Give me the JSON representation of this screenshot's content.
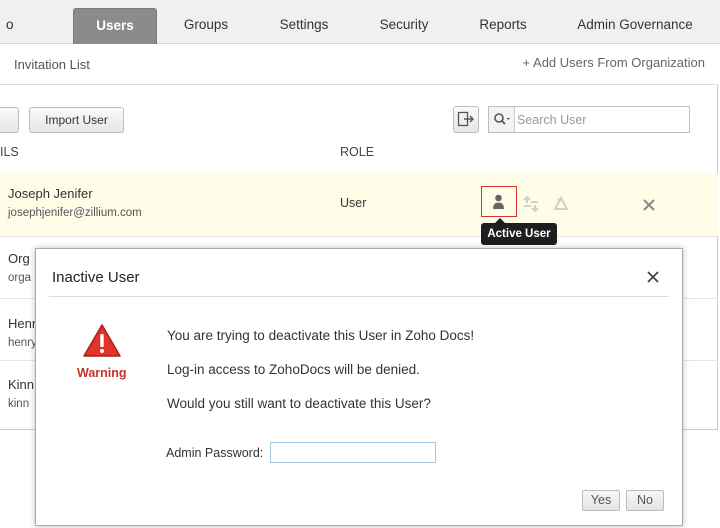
{
  "tabs": [
    {
      "label": "o Profile",
      "active": false
    },
    {
      "label": "Users",
      "active": true
    },
    {
      "label": "Groups",
      "active": false
    },
    {
      "label": "Settings",
      "active": false
    },
    {
      "label": "Security",
      "active": false
    },
    {
      "label": "Reports",
      "active": false
    },
    {
      "label": "Admin Governance",
      "active": false
    }
  ],
  "subbar": {
    "invitation_list": "Invitation List",
    "add_from_org": "+ Add Users From Organization"
  },
  "toolbar": {
    "import_label": "Import User",
    "search_placeholder": "Search User"
  },
  "table": {
    "col_details": "ILS",
    "col_role": "ROLE",
    "rows": [
      {
        "name": "Joseph Jenifer",
        "email": "josephjenifer@zillium.com",
        "role": "User"
      },
      {
        "name": "Org",
        "email": "orga",
        "role": ""
      },
      {
        "name": "Henr",
        "email": "henry",
        "role": ""
      },
      {
        "name": "Kinn",
        "email": "kinn",
        "role": ""
      }
    ]
  },
  "tooltip": "Active User",
  "dialog": {
    "title": "Inactive User",
    "warning_label": "Warning",
    "messages": [
      "You are trying to deactivate this User in Zoho Docs!",
      "Log-in access to ZohoDocs will be denied.",
      "Would you still want to deactivate this User?"
    ],
    "password_label": "Admin Password:",
    "password_value": "",
    "yes_label": "Yes",
    "no_label": "No"
  },
  "colors": {
    "active_tab": "#8b8b8b",
    "highlight_row": "#fdfde8",
    "warning_red": "#c8322a",
    "status_outline": "#d9342b"
  }
}
